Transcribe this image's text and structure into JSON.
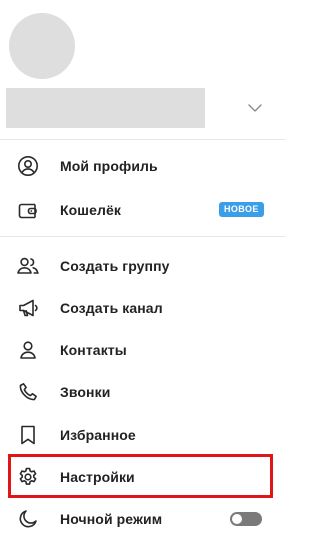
{
  "menu": {
    "profile": {
      "label": "Мой профиль",
      "icon": "user-circle-icon"
    },
    "wallet": {
      "label": "Кошелёк",
      "icon": "wallet-icon",
      "badge": "НОВОЕ"
    },
    "new_group": {
      "label": "Создать группу",
      "icon": "users-icon"
    },
    "new_channel": {
      "label": "Создать канал",
      "icon": "megaphone-icon"
    },
    "contacts": {
      "label": "Контакты",
      "icon": "person-icon"
    },
    "calls": {
      "label": "Звонки",
      "icon": "phone-icon"
    },
    "saved": {
      "label": "Избранное",
      "icon": "bookmark-icon"
    },
    "settings": {
      "label": "Настройки",
      "icon": "gear-icon"
    },
    "night_mode": {
      "label": "Ночной режим",
      "icon": "moon-icon",
      "toggle_on": false
    }
  },
  "colors": {
    "badge": "#3b9ee8",
    "highlight": "#e01616",
    "placeholder": "#dedede"
  }
}
